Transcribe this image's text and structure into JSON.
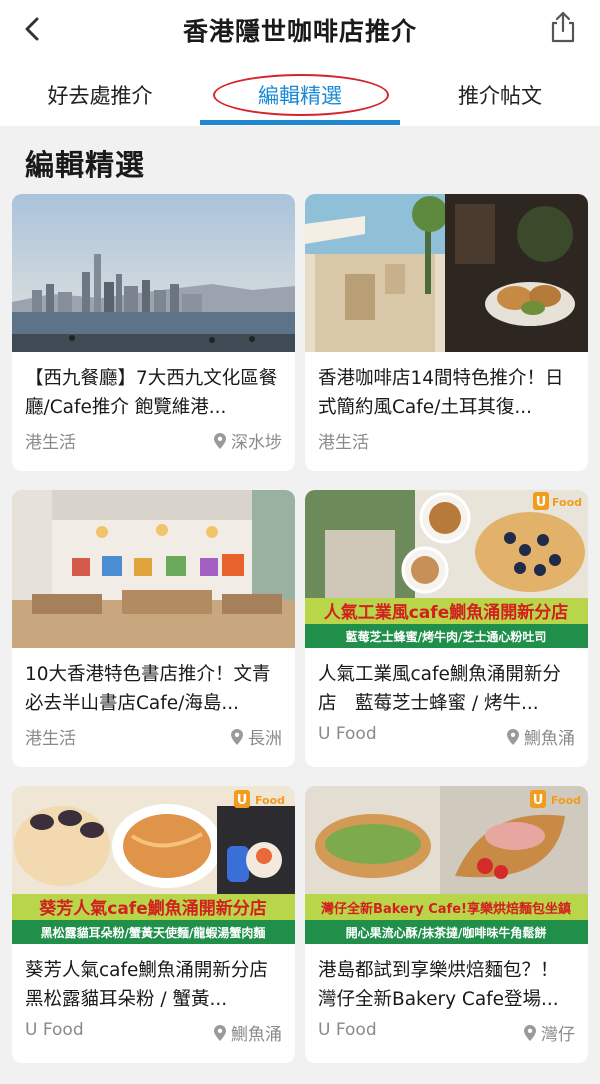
{
  "header": {
    "title": "香港隱世咖啡店推介",
    "back_icon": "chevron-left-icon",
    "share_icon": "share-icon"
  },
  "tabs": [
    {
      "label": "好去處推介"
    },
    {
      "label": "編輯精選",
      "active": true
    },
    {
      "label": "推介帖文"
    }
  ],
  "colors": {
    "accent": "#1f86d0",
    "annotation": "#d6232b"
  },
  "section": {
    "title": "編輯精選"
  },
  "cards": [
    {
      "title": "【西九餐廳】7大西九文化區餐廳/Cafe推介 飽覽維港...",
      "source": "港生活",
      "location": "深水埗"
    },
    {
      "title": "香港咖啡店14間特色推介！日式簡約風Cafe/土耳其復...",
      "source": "港生活",
      "location": ""
    },
    {
      "title": "10大香港特色書店推介！文青必去半山書店Cafe/海島...",
      "source": "港生活",
      "location": "長洲"
    },
    {
      "title": "人氣工業風cafe鰂魚涌開新分店　藍莓芝士蜂蜜 / 烤牛...",
      "source": "U Food",
      "location": "鰂魚涌",
      "banner": "人氣工業風cafe鰂魚涌開新分店",
      "subbanner": "藍莓芝士蜂蜜/烤牛肉/芝士通心粉吐司",
      "logo": "U Food"
    },
    {
      "title": "葵芳人氣cafe鰂魚涌開新分店　黑松露貓耳朵粉 / 蟹黃...",
      "source": "U Food",
      "location": "鰂魚涌",
      "banner": "葵芳人氣cafe鰂魚涌開新分店",
      "subbanner": "黑松露貓耳朵粉/蟹黃天使麵/龍蝦湯蟹肉麵",
      "logo": "U Food"
    },
    {
      "title": "港島都試到享樂烘焙麵包？！灣仔全新Bakery Cafe登場...",
      "source": "U Food",
      "location": "灣仔",
      "banner": "灣仔全新Bakery Cafe!享樂烘焙麵包坐鎮",
      "subbanner": "開心果流心酥/抹茶撻/咖啡味牛角鬆餅",
      "logo": "U Food"
    }
  ]
}
